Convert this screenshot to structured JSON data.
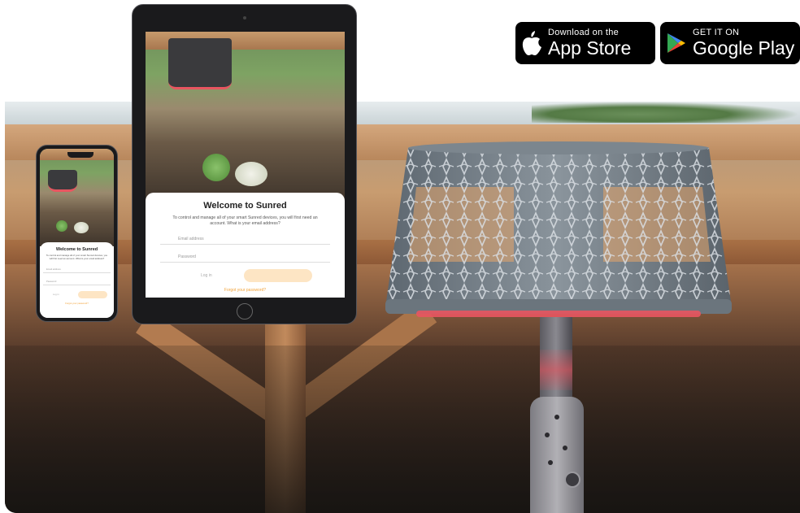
{
  "badges": {
    "app_store": {
      "small": "Download on the",
      "big": "App Store",
      "icon": "apple-icon"
    },
    "google_play": {
      "small": "GET IT ON",
      "big": "Google Play",
      "icon": "google-play-icon"
    }
  },
  "app_screen": {
    "title": "Welcome to Sunred",
    "description": "To control and manage all of your smart Sunred devices, you will first need an account. What is your email address?",
    "email_placeholder": "Email address",
    "password_placeholder": "Password",
    "login_label": "Log in",
    "forgot_label": "Forgot your password?"
  },
  "colors": {
    "accent": "#f2a33a",
    "button_bg": "#fde5c4",
    "heater_glow": "#e85560"
  }
}
